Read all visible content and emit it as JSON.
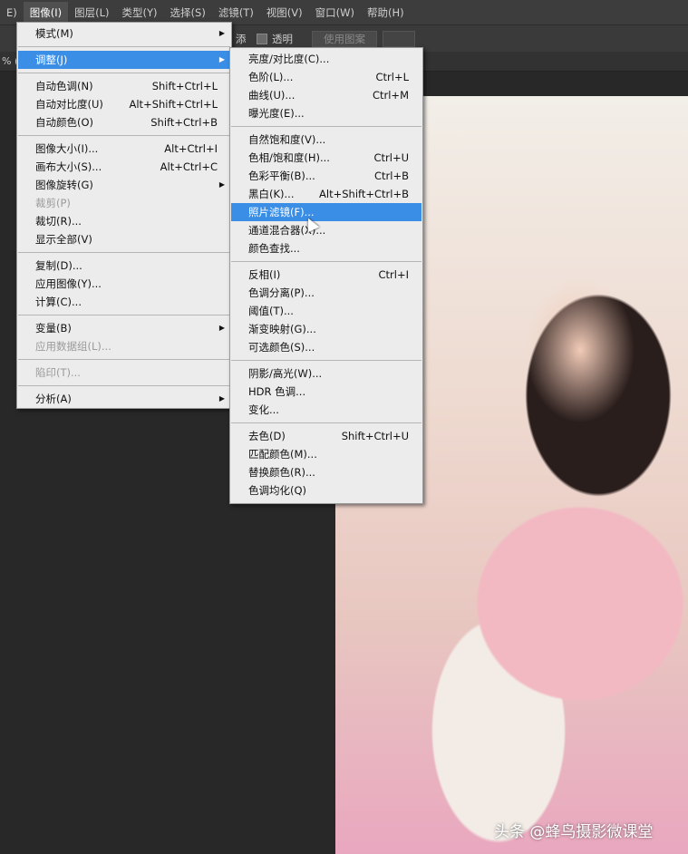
{
  "menubar": [
    "E)",
    "图像(I)",
    "图层(L)",
    "类型(Y)",
    "选择(S)",
    "滤镜(T)",
    "视图(V)",
    "窗口(W)",
    "帮助(H)"
  ],
  "options": {
    "partial_label": "添",
    "transparent_label": "透明",
    "use_pattern_button": "使用图案"
  },
  "tab": {
    "label": "% ("
  },
  "main_menu": [
    {
      "label": "模式(M)",
      "submenu": true
    },
    {
      "sep": true
    },
    {
      "label": "调整(J)",
      "submenu": true,
      "highlight": true
    },
    {
      "sep": true
    },
    {
      "label": "自动色调(N)",
      "shortcut": "Shift+Ctrl+L"
    },
    {
      "label": "自动对比度(U)",
      "shortcut": "Alt+Shift+Ctrl+L"
    },
    {
      "label": "自动颜色(O)",
      "shortcut": "Shift+Ctrl+B"
    },
    {
      "sep": true
    },
    {
      "label": "图像大小(I)...",
      "shortcut": "Alt+Ctrl+I"
    },
    {
      "label": "画布大小(S)...",
      "shortcut": "Alt+Ctrl+C"
    },
    {
      "label": "图像旋转(G)",
      "submenu": true
    },
    {
      "label": "裁剪(P)",
      "disabled": true
    },
    {
      "label": "裁切(R)..."
    },
    {
      "label": "显示全部(V)"
    },
    {
      "sep": true
    },
    {
      "label": "复制(D)..."
    },
    {
      "label": "应用图像(Y)..."
    },
    {
      "label": "计算(C)..."
    },
    {
      "sep": true
    },
    {
      "label": "变量(B)",
      "submenu": true
    },
    {
      "label": "应用数据组(L)...",
      "disabled": true
    },
    {
      "sep": true
    },
    {
      "label": "陷印(T)...",
      "disabled": true
    },
    {
      "sep": true
    },
    {
      "label": "分析(A)",
      "submenu": true
    }
  ],
  "adjust_menu": [
    {
      "label": "亮度/对比度(C)..."
    },
    {
      "label": "色阶(L)...",
      "shortcut": "Ctrl+L"
    },
    {
      "label": "曲线(U)...",
      "shortcut": "Ctrl+M"
    },
    {
      "label": "曝光度(E)..."
    },
    {
      "sep": true
    },
    {
      "label": "自然饱和度(V)..."
    },
    {
      "label": "色相/饱和度(H)...",
      "shortcut": "Ctrl+U"
    },
    {
      "label": "色彩平衡(B)...",
      "shortcut": "Ctrl+B"
    },
    {
      "label": "黑白(K)...",
      "shortcut": "Alt+Shift+Ctrl+B"
    },
    {
      "label": "照片滤镜(F)...",
      "highlight": true
    },
    {
      "label": "通道混合器(X)..."
    },
    {
      "label": "颜色查找..."
    },
    {
      "sep": true
    },
    {
      "label": "反相(I)",
      "shortcut": "Ctrl+I"
    },
    {
      "label": "色调分离(P)..."
    },
    {
      "label": "阈值(T)..."
    },
    {
      "label": "渐变映射(G)..."
    },
    {
      "label": "可选颜色(S)..."
    },
    {
      "sep": true
    },
    {
      "label": "阴影/高光(W)..."
    },
    {
      "label": "HDR 色调..."
    },
    {
      "label": "变化..."
    },
    {
      "sep": true
    },
    {
      "label": "去色(D)",
      "shortcut": "Shift+Ctrl+U"
    },
    {
      "label": "匹配颜色(M)..."
    },
    {
      "label": "替换颜色(R)..."
    },
    {
      "label": "色调均化(Q)"
    }
  ],
  "watermark": "头条 @蜂鸟摄影微课堂"
}
